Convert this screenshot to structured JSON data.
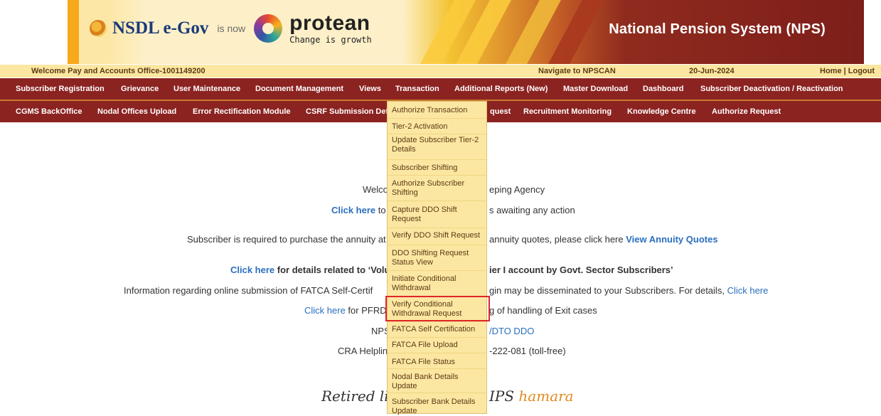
{
  "banner": {
    "nsdl_logo": "NSDL e-Gov",
    "is_now": "is now",
    "protean_logo": "protean",
    "protean_tagline": "Change is growth",
    "title": "National Pension System (NPS)"
  },
  "welcome": {
    "user": "Welcome Pay and Accounts Office-1001149200",
    "navigate": "Navigate to NPSCAN",
    "date": "20-Jun-2024",
    "links": "Home | Logout"
  },
  "menu1": [
    "Subscriber Registration",
    "Grievance",
    "User Maintenance",
    "Document Management",
    "Views",
    "Transaction",
    "Additional Reports (New)",
    "Master Download",
    "Dashboard",
    "Subscriber Deactivation / Reactivation"
  ],
  "menu2": [
    "CGMS BackOffice",
    "Nodal Offices Upload",
    "Error Rectification Module",
    "CSRF Submission Det",
    "quest",
    "Recruitment Monitoring",
    "Knowledge Centre",
    "Authorize Request"
  ],
  "dropdown": [
    "Authorize Transaction",
    "Tier-2 Activation",
    "Update Subscriber Tier-2 Details",
    "Subscriber Shifting",
    "Authorize Subscriber Shifting",
    "Capture DDO Shift Request",
    "Verify DDO Shift Request",
    "DDO Shifting Request Status View",
    "Initiate Conditional Withdrawal",
    "Verify Conditional Withdrawal Request",
    "FATCA Self Certification",
    "FATCA File Upload",
    "FATCA File Status",
    "Nodal Bank Details Update",
    "Subscriber Bank Details Update"
  ],
  "body": {
    "l1": "Welco",
    "l1b": "eping Agency",
    "l2_link": "Click here",
    "l2_a": "to",
    "l2_b": "s awaiting any action",
    "l3_a": "Subscriber is required to purchase the annuity at",
    "l3_b": "annuity quotes, please click here",
    "l3_link": "View Annuity Quotes",
    "l4_link": "Click here",
    "l4_a": "for details related to ‘Volu",
    "l4_b": "ier I account by Govt. Sector Subscribers’",
    "l5_a": "Information regarding online submission of FATCA Self-Certif",
    "l5_b": "gin may be disseminated to your Subscribers. For details,",
    "l5_link": "Click here",
    "l6_link": "Click here",
    "l6_a": "for PFRD",
    "l6_b": "g of handling of Exit cases",
    "l7_a": "NPS",
    "l7_link": "/DTO DDO",
    "l8_a": "CRA Helplin",
    "l8_b": "-222-081 (toll-free)",
    "retired_a": "Retired li",
    "retired_b": "IPS",
    "retired_c": "hamara"
  }
}
